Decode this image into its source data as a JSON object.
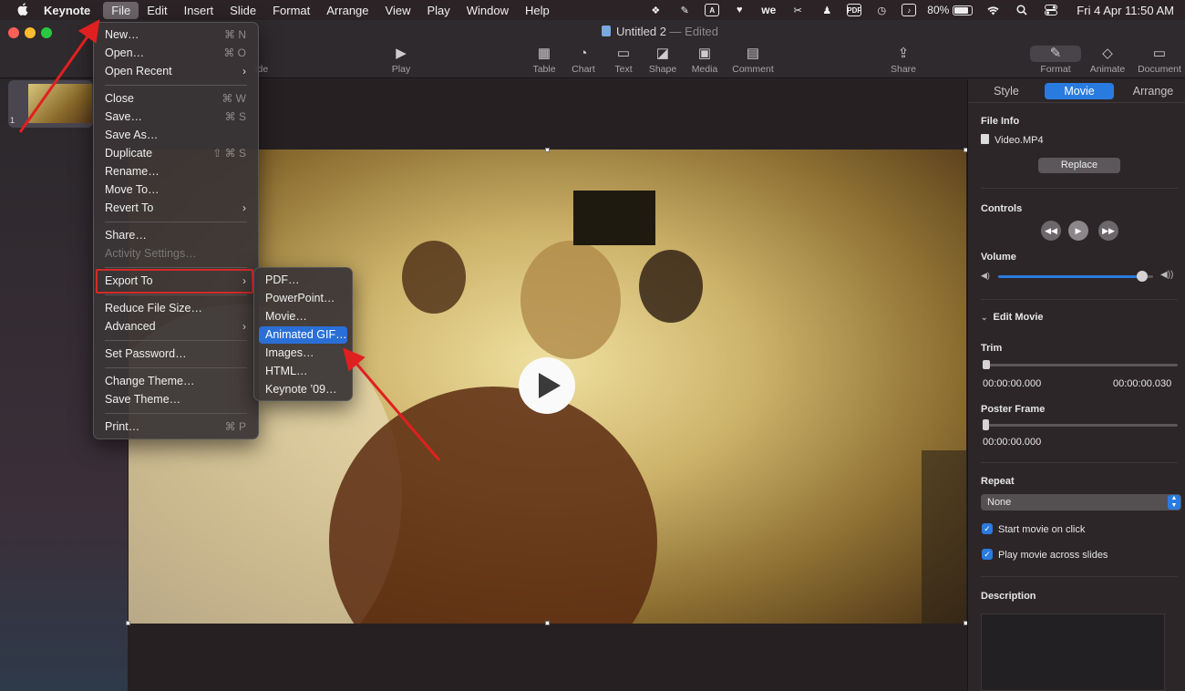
{
  "menubar": {
    "app_name": "Keynote",
    "items": [
      "File",
      "Edit",
      "Insert",
      "Slide",
      "Format",
      "Arrange",
      "View",
      "Play",
      "Window",
      "Help"
    ],
    "active_item": "File",
    "status_icons": [
      "dropbox-icon",
      "evernote-icon",
      "a-icon",
      "heart-icon",
      "we-icon",
      "k-icon",
      "user-icon",
      "pdf-icon",
      "clock-icon",
      "music-icon"
    ],
    "pdf_label": "PDF",
    "we_label": "we",
    "battery": "80%",
    "battery_level": 0.8,
    "clock": "Fri 4 Apr  11:50 AM"
  },
  "toolbar": {
    "doc_title": "Untitled 2",
    "edited_label": "— Edited",
    "buttons": {
      "slide": "lide",
      "play": "Play",
      "table": "Table",
      "chart": "Chart",
      "text": "Text",
      "shape": "Shape",
      "media": "Media",
      "comment": "Comment",
      "share": "Share",
      "format": "Format",
      "animate": "Animate",
      "document": "Document"
    }
  },
  "navigator": {
    "slide_number": "1"
  },
  "file_menu": {
    "new": "New…",
    "new_sc": "⌘ N",
    "open": "Open…",
    "open_sc": "⌘ O",
    "open_recent": "Open Recent",
    "close": "Close",
    "close_sc": "⌘ W",
    "save": "Save…",
    "save_sc": "⌘ S",
    "save_as": "Save As…",
    "duplicate": "Duplicate",
    "duplicate_sc": "⇧ ⌘ S",
    "rename": "Rename…",
    "move_to": "Move To…",
    "revert_to": "Revert To",
    "share": "Share…",
    "activity_settings": "Activity Settings…",
    "export_to": "Export To",
    "reduce_file_size": "Reduce File Size…",
    "advanced": "Advanced",
    "set_password": "Set Password…",
    "change_theme": "Change Theme…",
    "save_theme": "Save Theme…",
    "print": "Print…",
    "print_sc": "⌘ P"
  },
  "export_menu": {
    "pdf": "PDF…",
    "powerpoint": "PowerPoint…",
    "movie": "Movie…",
    "animated_gif": "Animated GIF…",
    "images": "Images…",
    "html": "HTML…",
    "keynote09": "Keynote ’09…"
  },
  "inspector": {
    "tabs": {
      "style": "Style",
      "movie": "Movie",
      "arrange": "Arrange"
    },
    "active_tab": "Movie",
    "file_info_label": "File Info",
    "file_name": "Video.MP4",
    "replace_button": "Replace",
    "controls_label": "Controls",
    "volume_label": "Volume",
    "volume_level": 0.93,
    "edit_movie_label": "Edit Movie",
    "trim_label": "Trim",
    "trim_start": "00:00:00.000",
    "trim_end": "00:00:00.030",
    "poster_frame_label": "Poster Frame",
    "poster_time": "00:00:00.000",
    "repeat_label": "Repeat",
    "repeat_value": "None",
    "start_on_click": "Start movie on click",
    "start_on_click_checked": true,
    "play_across_slides": "Play movie across slides",
    "play_across_slides_checked": true,
    "description_label": "Description"
  },
  "colors": {
    "accent": "#2a7be0",
    "highlight_box": "#d42a2a",
    "annotation_arrow": "#e02020"
  }
}
